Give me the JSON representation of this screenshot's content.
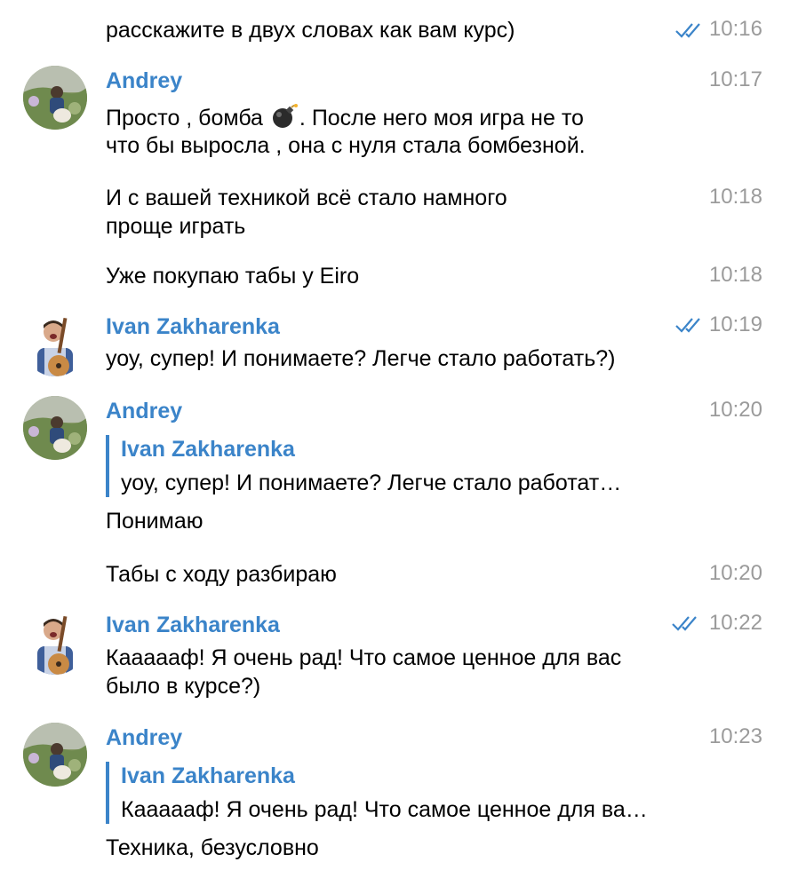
{
  "messages": {
    "m0": {
      "text": "расскажите в двух словах как вам курс)",
      "time": "10:16"
    },
    "m1": {
      "sender": "Andrey",
      "time": "10:17",
      "line1_before": "Просто , бомба",
      "line1_after": ". После него моя игра не то",
      "line2": "что бы выросла , она с нуля стала бомбезной.",
      "emoji": "bomb-emoji"
    },
    "m2": {
      "line1": "И с вашей техникой всё стало намного",
      "line2": "проще играть",
      "time": "10:18"
    },
    "m3": {
      "text": "Уже покупаю табы у Eiro",
      "time": "10:18"
    },
    "m4": {
      "sender": "Ivan Zakharenka",
      "text": "уоу, супер! И понимаете? Легче стало работать?)",
      "time": "10:19"
    },
    "m5": {
      "sender": "Andrey",
      "time": "10:20",
      "reply_name": "Ivan Zakharenka",
      "reply_text": "уоу, супер! И понимаете? Легче стало работат…",
      "text": "Понимаю"
    },
    "m6": {
      "text": "Табы с ходу разбираю",
      "time": "10:20"
    },
    "m7": {
      "sender": "Ivan Zakharenka",
      "line1": "Каааааф! Я очень рад! Что самое ценное для вас",
      "line2": "было в курсе?)",
      "time": "10:22"
    },
    "m8": {
      "sender": "Andrey",
      "time": "10:23",
      "reply_name": "Ivan Zakharenka",
      "reply_text": "Каааааф! Я очень рад! Что самое ценное для ва…",
      "text": "Техника, безусловно"
    }
  },
  "colors": {
    "accent": "#3b84c9",
    "time": "#9b9b9b",
    "text": "#000000"
  },
  "icons": {
    "read_receipt": "double-check-icon"
  }
}
